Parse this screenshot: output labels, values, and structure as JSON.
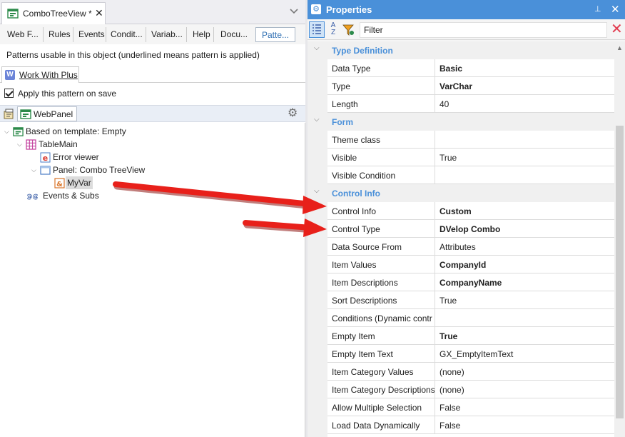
{
  "document": {
    "tab_title": "ComboTreeView *",
    "close_glyph": "✕",
    "dropdown_glyph": "⌄"
  },
  "editor_tabs": [
    {
      "label": "Web F..."
    },
    {
      "label": "Rules"
    },
    {
      "label": "Events"
    },
    {
      "label": "Condit..."
    },
    {
      "label": "Variab..."
    },
    {
      "label": "Help"
    },
    {
      "label": "Docu..."
    },
    {
      "label": "Patte..."
    }
  ],
  "patterns": {
    "note": "Patterns usable in this object (underlined means pattern is applied)",
    "tab_label": "Work With Plus",
    "apply_checked": true,
    "apply_label": "Apply this pattern on save",
    "toolbar_item": "WebPanel"
  },
  "tree": [
    {
      "label": "Based on template: Empty",
      "icon": "webpanel-icon",
      "chev": "⌵"
    },
    {
      "label": "TableMain",
      "icon": "table-icon",
      "chev": "⌵"
    },
    {
      "label": "Error viewer",
      "icon": "error-viewer-icon",
      "chev": ""
    },
    {
      "label": "Panel: Combo TreeView",
      "icon": "panel-icon",
      "chev": "⌵"
    },
    {
      "label": "MyVar",
      "icon": "variable-icon",
      "chev": ""
    },
    {
      "label": "Events & Subs",
      "icon": "events-icon",
      "chev": ""
    }
  ],
  "properties": {
    "title": "Properties",
    "pin_glyph": "⊥",
    "close_glyph": "✕",
    "filter_label": "Filter",
    "clear_glyph": "✕",
    "categories": [
      {
        "label": "Type Definition",
        "rows": [
          {
            "name": "Data Type",
            "value": "Basic",
            "bold": true
          },
          {
            "name": "Type",
            "value": "VarChar",
            "bold": true
          },
          {
            "name": "Length",
            "value": "40",
            "bold": false
          }
        ]
      },
      {
        "label": "Form",
        "rows": [
          {
            "name": "Theme class",
            "value": "",
            "bold": false
          },
          {
            "name": "Visible",
            "value": "True",
            "bold": false
          },
          {
            "name": "Visible Condition",
            "value": "",
            "bold": false
          }
        ]
      },
      {
        "label": "Control Info",
        "rows": [
          {
            "name": "Control Info",
            "value": "Custom",
            "bold": true
          },
          {
            "name": "Control Type",
            "value": "DVelop Combo",
            "bold": true
          },
          {
            "name": "Data Source From",
            "value": "Attributes",
            "bold": false
          },
          {
            "name": "Item Values",
            "value": "CompanyId",
            "bold": true
          },
          {
            "name": "Item Descriptions",
            "value": "CompanyName",
            "bold": true
          },
          {
            "name": "Sort Descriptions",
            "value": "True",
            "bold": false
          },
          {
            "name": "Conditions (Dynamic contr",
            "value": "",
            "bold": false
          },
          {
            "name": "Empty Item",
            "value": "True",
            "bold": true
          },
          {
            "name": "Empty Item Text",
            "value": "GX_EmptyItemText",
            "bold": false
          },
          {
            "name": "Item Category Values",
            "value": "(none)",
            "bold": false
          },
          {
            "name": "Item Category Descriptions",
            "value": "(none)",
            "bold": false
          },
          {
            "name": "Allow Multiple Selection",
            "value": "False",
            "bold": false
          },
          {
            "name": "Load Data Dynamically",
            "value": "False",
            "bold": false
          }
        ]
      }
    ]
  },
  "colors": {
    "accent": "#4a90d9",
    "arrow": "#e8201a",
    "clear": "#e23c50"
  }
}
